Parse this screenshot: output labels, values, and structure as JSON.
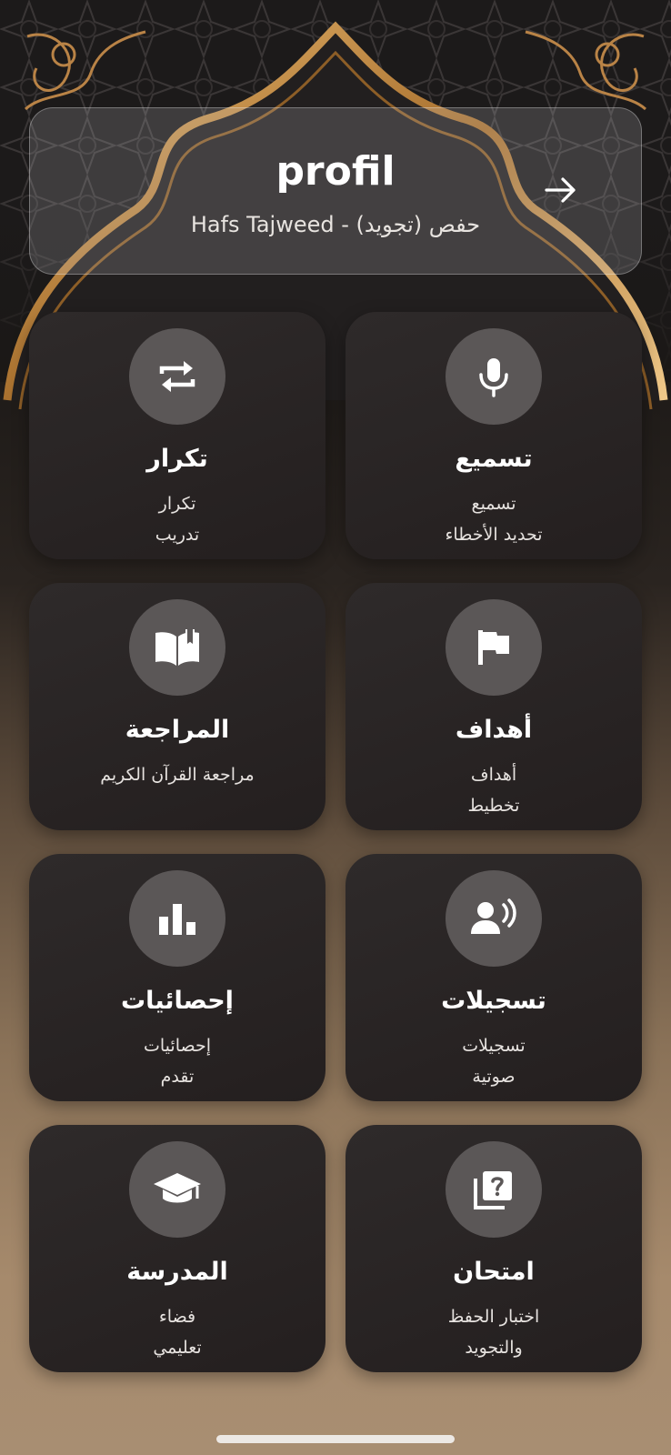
{
  "header": {
    "title": "profil",
    "subtitle": "Hafs Tajweed - (تجويد) حفص",
    "arrow_icon": "arrow-right-icon"
  },
  "colors": {
    "accent_gold": "#c8914a",
    "card_bg": "#2a2626",
    "icon_circle": "#5b5757"
  },
  "cards": [
    {
      "title": "تسميع",
      "lines": [
        "تسميع",
        "تحديد الأخطاء"
      ],
      "icon": "microphone-icon"
    },
    {
      "title": "تكرار",
      "lines": [
        "تكرار",
        "تدريب"
      ],
      "icon": "repeat-icon"
    },
    {
      "title": "أهداف",
      "lines": [
        "أهداف",
        "تخطيط"
      ],
      "icon": "flag-icon"
    },
    {
      "title": "المراجعة",
      "lines": [
        "مراجعة القرآن الكريم",
        ""
      ],
      "icon": "open-book-icon"
    },
    {
      "title": "تسجيلات",
      "lines": [
        "تسجيلات",
        "صوتية"
      ],
      "icon": "voice-recording-icon"
    },
    {
      "title": "إحصائيات",
      "lines": [
        "إحصائيات",
        "تقدم"
      ],
      "icon": "bar-chart-icon"
    },
    {
      "title": "امتحان",
      "lines": [
        "اختبار الحفظ",
        "والتجويد"
      ],
      "icon": "quiz-icon"
    },
    {
      "title": "المدرسة",
      "lines": [
        "فضاء",
        "تعليمي"
      ],
      "icon": "graduation-cap-icon"
    }
  ]
}
